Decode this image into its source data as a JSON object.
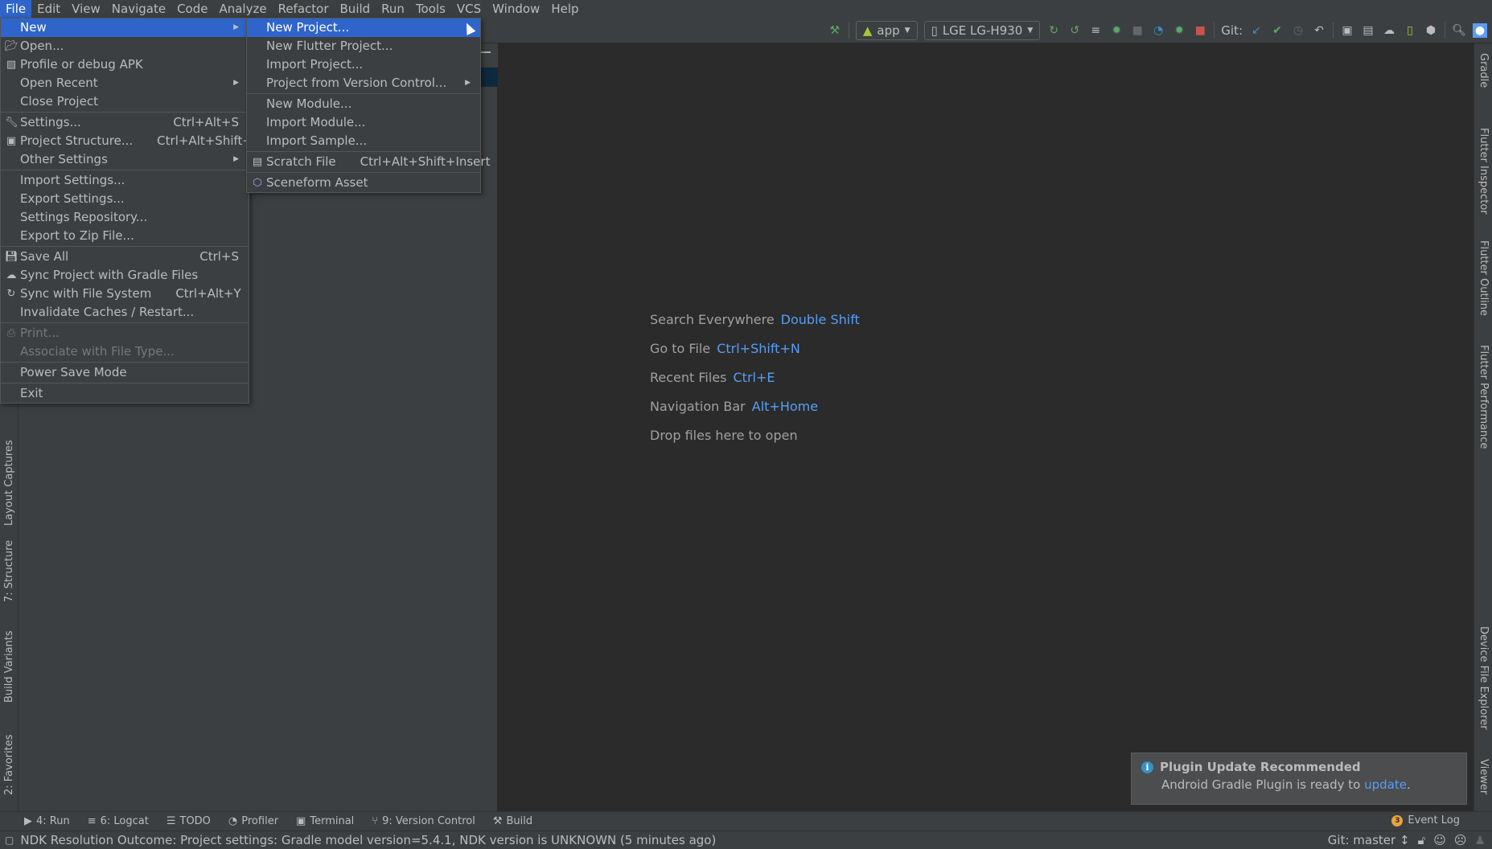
{
  "menubar": {
    "items": [
      "File",
      "Edit",
      "View",
      "Navigate",
      "Code",
      "Analyze",
      "Refactor",
      "Build",
      "Run",
      "Tools",
      "VCS",
      "Window",
      "Help"
    ],
    "active": "File"
  },
  "toolbar": {
    "run_config": "app",
    "device": "LGE LG-H930",
    "git_label": "Git:",
    "icons": [
      "hammer-icon",
      "apply-changes-icon",
      "apply-code-changes-icon",
      "coverage-icon",
      "debug-icon",
      "profile-icon",
      "profiler-gauge-icon",
      "attach-debugger-icon",
      "stop-icon",
      "git-update-icon",
      "git-commit-icon",
      "git-history-icon",
      "git-revert-icon",
      "project-structure-icon",
      "sdk-manager-icon",
      "gradle-sync-icon",
      "avd-manager-icon",
      "sdk-download-icon",
      "search-icon",
      "avatar-icon"
    ]
  },
  "file_menu": {
    "items": [
      {
        "label": "New",
        "icon": "",
        "shortcut": "",
        "submenu": true,
        "selected": true
      },
      {
        "label": "Open...",
        "icon": "folder-icon",
        "shortcut": ""
      },
      {
        "label": "Profile or debug APK",
        "icon": "apk-icon",
        "shortcut": ""
      },
      {
        "label": "Open Recent",
        "icon": "",
        "shortcut": "",
        "submenu": true
      },
      {
        "label": "Close Project",
        "icon": "",
        "shortcut": ""
      },
      {
        "divider": true
      },
      {
        "label": "Settings...",
        "icon": "wrench-icon",
        "shortcut": "Ctrl+Alt+S"
      },
      {
        "label": "Project Structure...",
        "icon": "project-structure-icon",
        "shortcut": "Ctrl+Alt+Shift+S"
      },
      {
        "label": "Other Settings",
        "icon": "",
        "shortcut": "",
        "submenu": true
      },
      {
        "divider": true
      },
      {
        "label": "Import Settings...",
        "icon": "",
        "shortcut": ""
      },
      {
        "label": "Export Settings...",
        "icon": "",
        "shortcut": ""
      },
      {
        "label": "Settings Repository...",
        "icon": "",
        "shortcut": ""
      },
      {
        "label": "Export to Zip File...",
        "icon": "",
        "shortcut": ""
      },
      {
        "divider": true
      },
      {
        "label": "Save All",
        "icon": "save-icon",
        "shortcut": "Ctrl+S"
      },
      {
        "label": "Sync Project with Gradle Files",
        "icon": "gradle-sync-icon",
        "shortcut": ""
      },
      {
        "label": "Sync with File System",
        "icon": "refresh-icon",
        "shortcut": "Ctrl+Alt+Y"
      },
      {
        "label": "Invalidate Caches / Restart...",
        "icon": "",
        "shortcut": ""
      },
      {
        "divider": true
      },
      {
        "label": "Print...",
        "icon": "print-icon",
        "shortcut": "",
        "disabled": true
      },
      {
        "label": "Associate with File Type...",
        "icon": "",
        "shortcut": "",
        "disabled": true
      },
      {
        "divider": true
      },
      {
        "label": "Power Save Mode",
        "icon": "",
        "shortcut": ""
      },
      {
        "divider": true
      },
      {
        "label": "Exit",
        "icon": "",
        "shortcut": ""
      }
    ]
  },
  "new_menu": {
    "items": [
      {
        "label": "New Project...",
        "icon": "",
        "shortcut": "",
        "selected": true
      },
      {
        "label": "New Flutter Project...",
        "icon": "",
        "shortcut": ""
      },
      {
        "label": "Import Project...",
        "icon": "",
        "shortcut": ""
      },
      {
        "label": "Project from Version Control...",
        "icon": "",
        "shortcut": "",
        "submenu": true
      },
      {
        "divider": true
      },
      {
        "label": "New Module...",
        "icon": "",
        "shortcut": ""
      },
      {
        "label": "Import Module...",
        "icon": "",
        "shortcut": ""
      },
      {
        "label": "Import Sample...",
        "icon": "",
        "shortcut": ""
      },
      {
        "divider": true
      },
      {
        "label": "Scratch File",
        "icon": "scratch-file-icon",
        "shortcut": "Ctrl+Alt+Shift+Insert"
      },
      {
        "divider": true
      },
      {
        "label": "Sceneform Asset",
        "icon": "cube-icon",
        "shortcut": ""
      }
    ]
  },
  "editor_hints": [
    {
      "label": "Search Everywhere",
      "key": "Double Shift"
    },
    {
      "label": "Go to File",
      "key": "Ctrl+Shift+N"
    },
    {
      "label": "Recent Files",
      "key": "Ctrl+E"
    },
    {
      "label": "Navigation Bar",
      "key": "Alt+Home"
    },
    {
      "label": "Drop files here to open",
      "key": ""
    }
  ],
  "left_tool_tabs": [
    "Layout Captures",
    "7: Structure",
    "Build Variants",
    "2: Favorites"
  ],
  "right_tool_tabs": [
    "Gradle",
    "Flutter Inspector",
    "Flutter Outline",
    "Flutter Performance",
    "Device File Explorer",
    "Viewer"
  ],
  "bottom_tabs": [
    "4: Run",
    "6: Logcat",
    "TODO",
    "Profiler",
    "Terminal",
    "9: Version Control",
    "Build"
  ],
  "event_log": {
    "label": "Event Log",
    "count": "3"
  },
  "notification": {
    "title": "Plugin Update Recommended",
    "body_prefix": "Android Gradle Plugin is ready to ",
    "link": "update",
    "body_suffix": "."
  },
  "status_bar": {
    "message": "NDK Resolution Outcome: Project settings: Gradle model version=5.4.1, NDK version is UNKNOWN (5 minutes ago)",
    "git_branch": "Git: master ↕"
  },
  "colors": {
    "accent": "#2f65ca",
    "link": "#589df6",
    "background": "#2b2b2b",
    "panel": "#3c3f41"
  }
}
